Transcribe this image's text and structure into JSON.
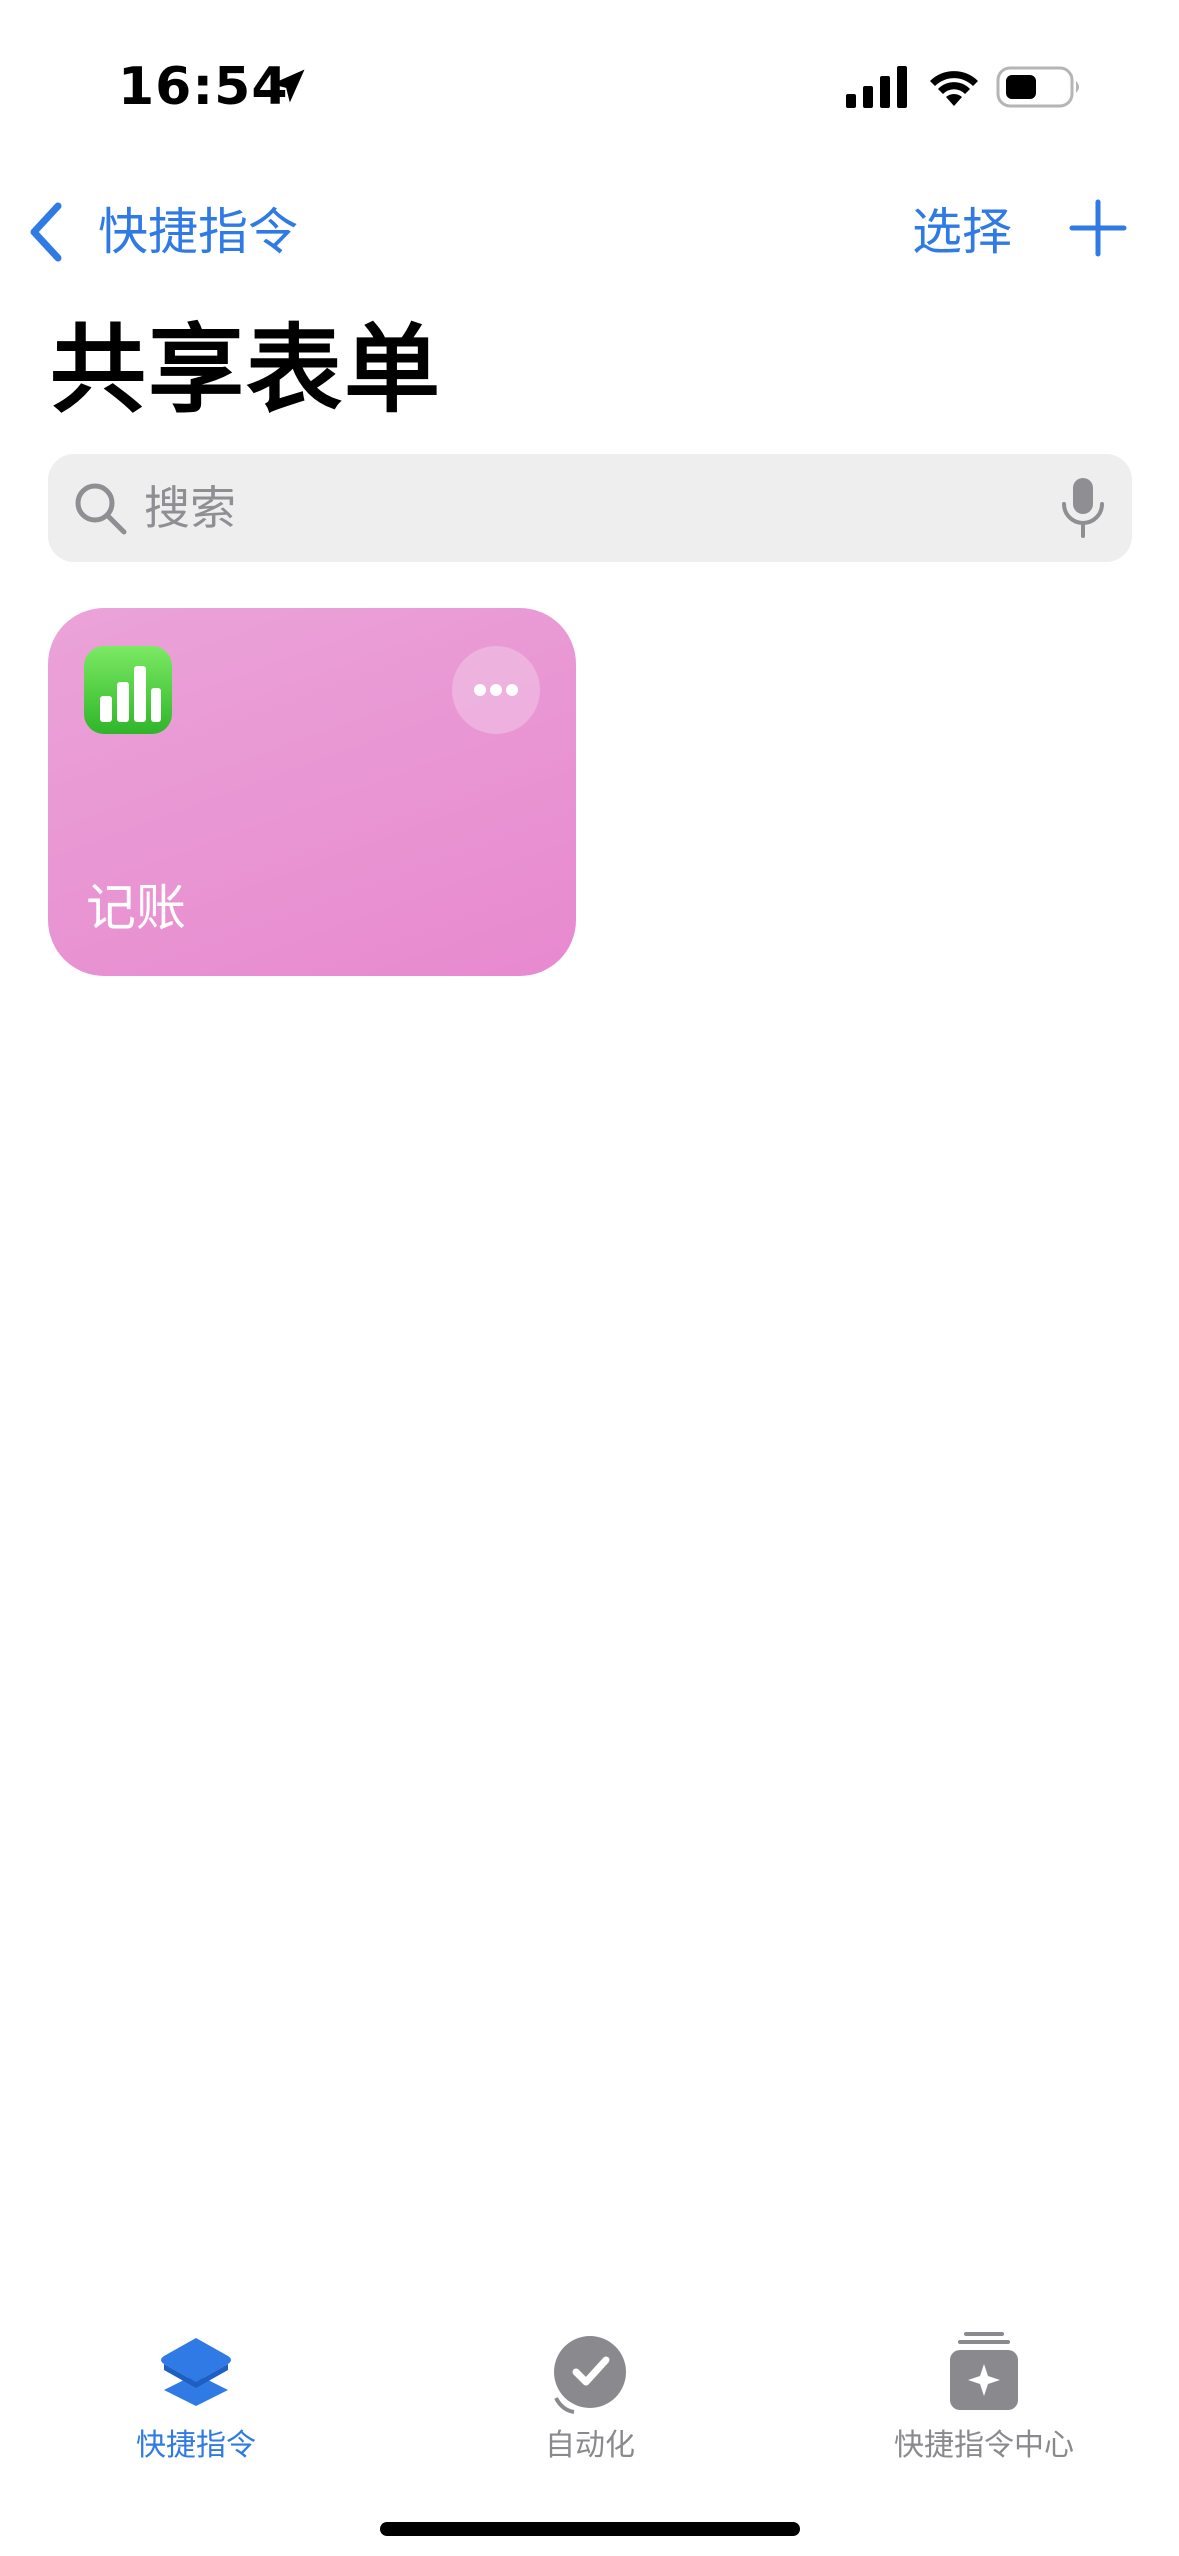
{
  "status_bar": {
    "time": "16:54",
    "icons": [
      "location-arrow-icon",
      "cellular-signal-icon",
      "wifi-icon",
      "battery-icon"
    ]
  },
  "nav": {
    "back_label": "快捷指令",
    "select_label": "选择",
    "add_icon": "plus-icon"
  },
  "page": {
    "title": "共享表单"
  },
  "search": {
    "placeholder": "搜索",
    "value": ""
  },
  "shortcuts": [
    {
      "title": "记账",
      "app_icon": "numbers-chart-icon",
      "tile_color": "#e889cf"
    }
  ],
  "tabs": [
    {
      "label": "快捷指令",
      "icon": "shortcuts-layers-icon",
      "active": true
    },
    {
      "label": "自动化",
      "icon": "automation-check-icon",
      "active": false
    },
    {
      "label": "快捷指令中心",
      "icon": "gallery-sparkle-icon",
      "active": false
    }
  ],
  "colors": {
    "accent": "#2f7ae5",
    "inactive": "#8a8a8e",
    "search_bg": "#eeeeef"
  }
}
